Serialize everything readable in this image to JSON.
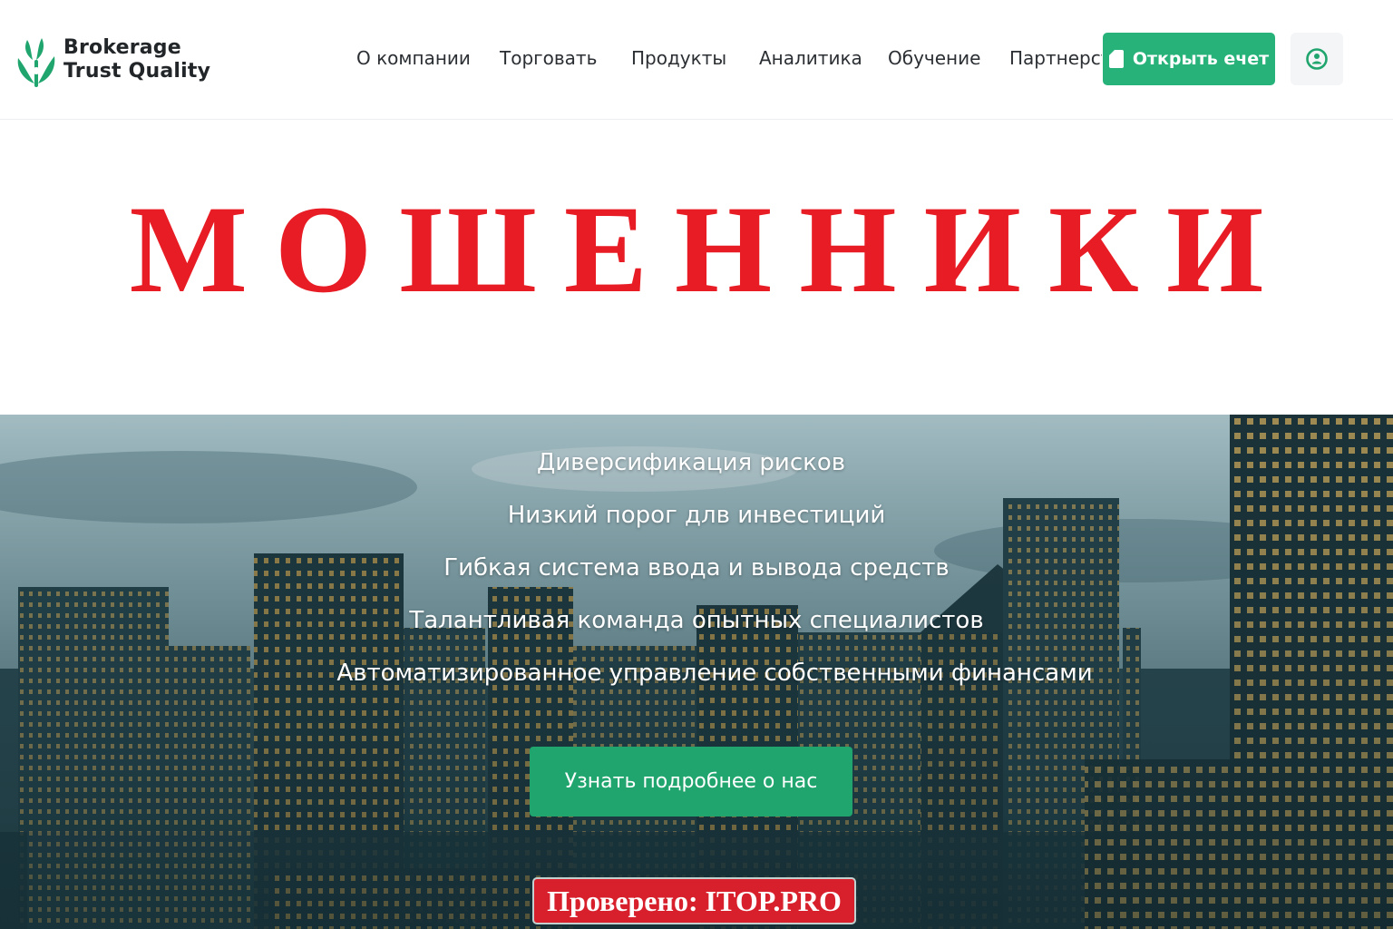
{
  "brand": {
    "line1": "Brokerage",
    "line2": "Trust Quality",
    "color": "#1fa56d"
  },
  "nav": {
    "items": [
      {
        "label": "О компании"
      },
      {
        "label": "Торговать"
      },
      {
        "label": "Продукты"
      },
      {
        "label": "Аналитика"
      },
      {
        "label": "Обучение"
      },
      {
        "label": "Партнерст"
      }
    ]
  },
  "header": {
    "open_account_label": "Открыть ечет",
    "open_account_icon": "document-icon",
    "login_icon": "user-circle-icon",
    "accent": "#27b27a"
  },
  "stamp": {
    "text": "МОШЕННИКИ",
    "color": "#e81c24"
  },
  "hero": {
    "features": [
      "Диверсификация рисков",
      "Низкий порог длв инвестиций",
      "Гибкая система ввода и вывода средств",
      "Талантливая команда опытных специалистов",
      "Автоматизированное управление собственными финансами"
    ],
    "cta_label": "Узнать подробнее о нас"
  },
  "verified_badge": {
    "text": "Проверено: ITOP.PRO",
    "color": "#d8202c"
  }
}
